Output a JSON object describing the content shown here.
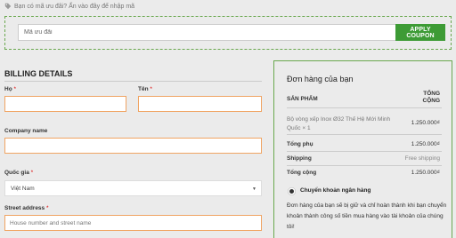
{
  "coupon": {
    "notice": "Bạn có mã ưu đãi? Ấn vào đây để nhập mã",
    "input_placeholder": "Mã ưu đãi",
    "button_label": "APPLY COUPON"
  },
  "billing": {
    "title": "BILLING DETAILS",
    "fields": {
      "last_name_label": "Họ",
      "first_name_label": "Tên",
      "company_label": "Company name",
      "country_label": "Quốc gia",
      "country_value": "Việt Nam",
      "street_label": "Street address",
      "street_placeholder": "House number and street name"
    },
    "required_mark": "*"
  },
  "order": {
    "title": "Đơn hàng của bạn",
    "col_product": "SẢN PHẨM",
    "col_total": "TỔNG CỘNG",
    "product_name": "Bộ vòng xếp Inox Ø32 Thế Hệ Mới Minh Quốc × 1",
    "product_price": "1.250.000₫",
    "subtotal_label": "Tổng phụ",
    "subtotal_value": "1.250.000₫",
    "shipping_label": "Shipping",
    "shipping_value": "Free shipping",
    "total_label": "Tổng cộng",
    "total_value": "1.250.000₫",
    "payment_method": "Chuyển khoản ngân hàng",
    "payment_desc": "Đơn hàng của bạn sẽ bị giữ và chỉ hoàn thành khi bạn chuyển khoản thành công số tiền mua hàng vào tài khoản của chúng tôi!"
  },
  "colors": {
    "accent_green": "#3d9b35",
    "input_border_orange": "#f0a463",
    "required_red": "#dd0000"
  },
  "icons": {
    "coupon_icon": "tag-icon",
    "select_icon": "chevron-down-icon"
  }
}
